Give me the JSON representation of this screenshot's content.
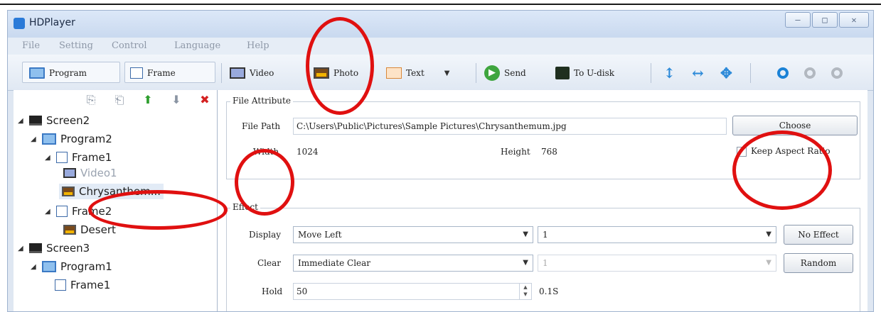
{
  "window": {
    "title": "HDPlayer",
    "controls": [
      "—",
      "□",
      "✕"
    ]
  },
  "menu": [
    "File",
    "Setting",
    "Control",
    "Language",
    "Help"
  ],
  "toolbar": {
    "program": "Program",
    "frame": "Frame",
    "video": "Video",
    "photo": "Photo",
    "text": "Text",
    "send": "Send",
    "to_udisk": "To U-disk"
  },
  "tree_tools": [
    "⎘",
    "⎗",
    "⬆",
    "⬇",
    "✖"
  ],
  "tree": [
    {
      "label": "Screen2"
    },
    {
      "label": "Program2"
    },
    {
      "label": "Frame1"
    },
    {
      "label": "Video1"
    },
    {
      "label": "Chrysanthem..."
    },
    {
      "label": "Frame2"
    },
    {
      "label": "Desert"
    },
    {
      "label": "Screen3"
    },
    {
      "label": "Program1"
    },
    {
      "label": "Frame1"
    }
  ],
  "file_attribute": {
    "legend": "File Attribute",
    "path_label": "File Path",
    "path_value": "C:\\Users\\Public\\Pictures\\Sample Pictures\\Chrysanthemum.jpg",
    "choose": "Choose",
    "width_label": "Width",
    "width_value": "1024",
    "height_label": "Height",
    "height_value": "768",
    "keep_aspect": "Keep Aspect Ratio"
  },
  "effect": {
    "legend": "Effect",
    "display_label": "Display",
    "display_value": "Move Left",
    "display_speed": "1",
    "no_effect": "No Effect",
    "clear_label": "Clear",
    "clear_value": "Immediate Clear",
    "clear_speed": "1",
    "random": "Random",
    "hold_label": "Hold",
    "hold_value": "50",
    "hold_seconds": "0.1S"
  },
  "colors": {
    "annotation": "#e01010",
    "accent": "#1b82d6"
  }
}
